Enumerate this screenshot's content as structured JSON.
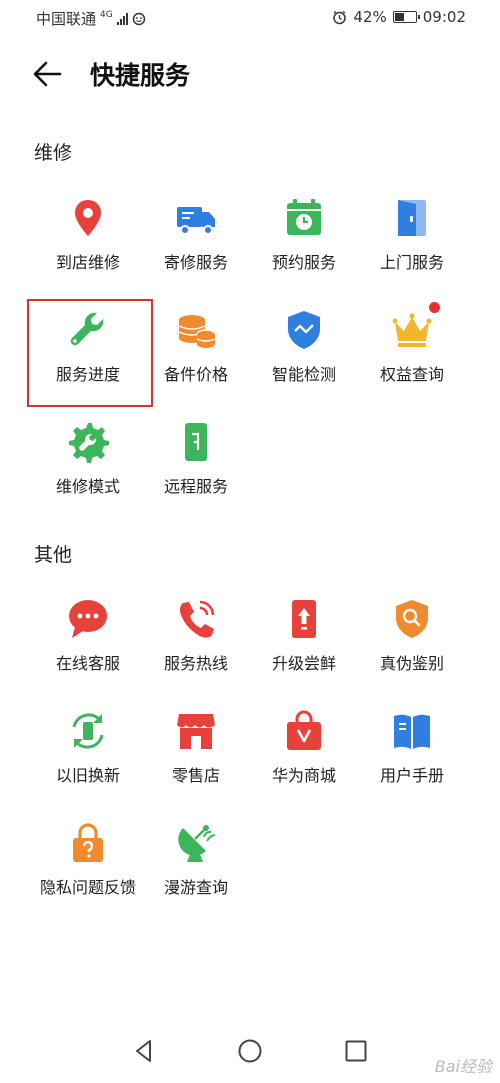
{
  "status": {
    "carrier": "中国联通",
    "net": "4G",
    "battery": "42%",
    "battery_level": 0.42,
    "time": "09:02"
  },
  "header": {
    "title": "快捷服务"
  },
  "sections": [
    {
      "title": "维修",
      "items": [
        {
          "label": "到店维修",
          "icon": "location-pin-icon",
          "color": "#e8413b"
        },
        {
          "label": "寄修服务",
          "icon": "delivery-truck-icon",
          "color": "#2f7fe0"
        },
        {
          "label": "预约服务",
          "icon": "calendar-clock-icon",
          "color": "#3db55b"
        },
        {
          "label": "上门服务",
          "icon": "door-icon",
          "color": "#2f7fe0"
        },
        {
          "label": "服务进度",
          "icon": "wrench-icon",
          "color": "#3db55b"
        },
        {
          "label": "备件价格",
          "icon": "coins-icon",
          "color": "#f08a2e"
        },
        {
          "label": "智能检测",
          "icon": "shield-check-icon",
          "color": "#2f7fe0"
        },
        {
          "label": "权益查询",
          "icon": "crown-icon",
          "color": "#f2b52c"
        },
        {
          "label": "维修模式",
          "icon": "gear-wrench-icon",
          "color": "#3db55b"
        },
        {
          "label": "远程服务",
          "icon": "phone-remote-icon",
          "color": "#3db55b"
        }
      ]
    },
    {
      "title": "其他",
      "items": [
        {
          "label": "在线客服",
          "icon": "chat-bubble-icon",
          "color": "#e8413b"
        },
        {
          "label": "服务热线",
          "icon": "phone-call-icon",
          "color": "#e8413b"
        },
        {
          "label": "升级尝鲜",
          "icon": "phone-upgrade-icon",
          "color": "#e8413b"
        },
        {
          "label": "真伪鉴别",
          "icon": "search-shield-icon",
          "color": "#f08a2e"
        },
        {
          "label": "以旧换新",
          "icon": "trade-in-icon",
          "color": "#3db55b"
        },
        {
          "label": "零售店",
          "icon": "store-icon",
          "color": "#e8413b"
        },
        {
          "label": "华为商城",
          "icon": "shopping-bag-icon",
          "color": "#e8413b"
        },
        {
          "label": "用户手册",
          "icon": "book-icon",
          "color": "#2f7fe0"
        },
        {
          "label": "隐私问题反馈",
          "icon": "lock-question-icon",
          "color": "#f08a2e"
        },
        {
          "label": "漫游查询",
          "icon": "satellite-dish-icon",
          "color": "#3db55b"
        }
      ]
    }
  ],
  "watermark": "Bai经验"
}
